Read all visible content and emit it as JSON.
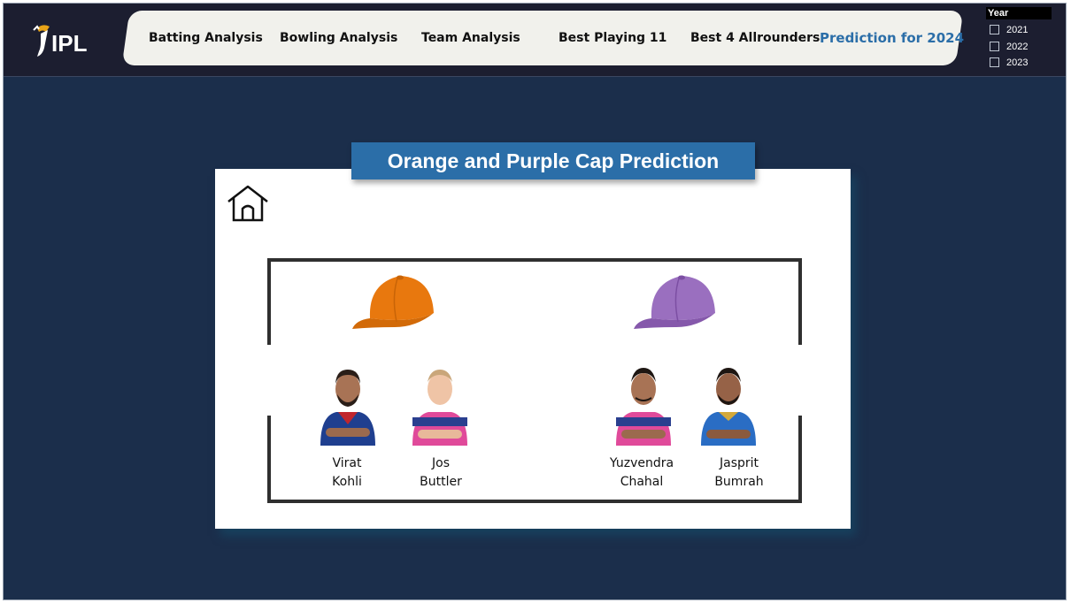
{
  "header": {
    "logo_text": "IPL",
    "nav": [
      {
        "label": "Batting Analysis"
      },
      {
        "label": "Bowling Analysis"
      },
      {
        "label": "Team Analysis"
      },
      {
        "label": "Best Playing 11"
      },
      {
        "label": "Best 4 Allrounders"
      },
      {
        "label": "Prediction for 2024",
        "active": true
      }
    ]
  },
  "year_slicer": {
    "title": "Year",
    "options": [
      {
        "label": "2021",
        "checked": false
      },
      {
        "label": "2022",
        "checked": false
      },
      {
        "label": "2023",
        "checked": false
      }
    ]
  },
  "page": {
    "title": "Orange and Purple Cap Prediction"
  },
  "caps": {
    "orange": {
      "color": "#e8780e",
      "players": [
        {
          "line1": "Virat",
          "line2": "Kohli",
          "jersey": "#1f3f8f"
        },
        {
          "line1": "Jos",
          "line2": "Buttler",
          "jersey": "#e04a9a"
        }
      ]
    },
    "purple": {
      "color": "#8f63b5",
      "players": [
        {
          "line1": "Yuzvendra",
          "line2": "Chahal",
          "jersey": "#e04a9a"
        },
        {
          "line1": "Jasprit",
          "line2": "Bumrah",
          "jersey": "#2a6dc4"
        }
      ]
    }
  },
  "colors": {
    "background": "#1b2e4b",
    "topbar": "#1c1e30",
    "accent": "#2b6ea8"
  }
}
